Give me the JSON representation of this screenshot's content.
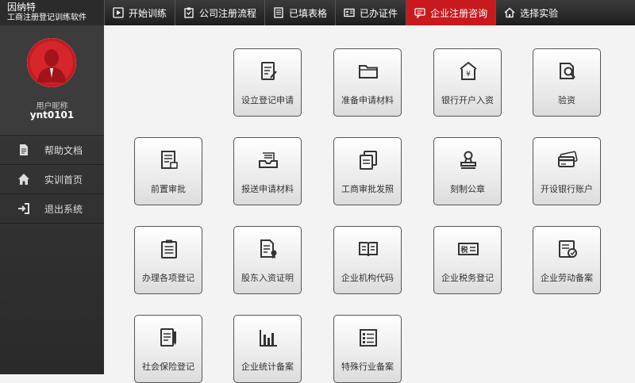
{
  "brand": {
    "name": "因纳特",
    "subtitle": "工商注册登记训练软件"
  },
  "tabs": [
    {
      "label": "开始训练",
      "icon": "play-icon"
    },
    {
      "label": "公司注册流程",
      "icon": "clipboard-icon"
    },
    {
      "label": "已填表格",
      "icon": "document-icon"
    },
    {
      "label": "已办证件",
      "icon": "id-card-icon"
    },
    {
      "label": "企业注册咨询",
      "icon": "chat-icon"
    },
    {
      "label": "选择实验",
      "icon": "home-icon"
    }
  ],
  "active_tab": 4,
  "accent_color": "#c8191f",
  "profile": {
    "nickname_label": "用户昵称",
    "username": "ynt0101"
  },
  "sidebar": {
    "items": [
      {
        "label": "帮助文档",
        "icon": "document-icon"
      },
      {
        "label": "实训首页",
        "icon": "home-icon"
      },
      {
        "label": "退出系统",
        "icon": "logout-icon"
      }
    ]
  },
  "tiles": [
    {
      "label": "设立登记申请",
      "icon": "form-pen-icon"
    },
    {
      "label": "准备申请材料",
      "icon": "folder-icon"
    },
    {
      "label": "银行开户入资",
      "icon": "bank-icon"
    },
    {
      "label": "验资",
      "icon": "magnify-document-icon"
    },
    {
      "label": "前置审批",
      "icon": "approval-document-icon"
    },
    {
      "label": "报送申请材料",
      "icon": "inbox-tray-icon"
    },
    {
      "label": "工商审批发照",
      "icon": "license-copy-icon"
    },
    {
      "label": "刻制公章",
      "icon": "stamp-icon"
    },
    {
      "label": "开设银行账户",
      "icon": "bank-card-icon"
    },
    {
      "label": "办理各项登记",
      "icon": "clipboard-list-icon"
    },
    {
      "label": "股东入资证明",
      "icon": "certificate-icon"
    },
    {
      "label": "企业机构代码",
      "icon": "open-book-icon"
    },
    {
      "label": "企业税务登记",
      "icon": "tax-ticket-icon"
    },
    {
      "label": "企业劳动备案",
      "icon": "labor-record-icon"
    },
    {
      "label": "社会保险登记",
      "icon": "insurance-form-icon"
    },
    {
      "label": "企业统计备案",
      "icon": "bar-chart-icon"
    },
    {
      "label": "特殊行业备案",
      "icon": "list-table-icon"
    }
  ]
}
